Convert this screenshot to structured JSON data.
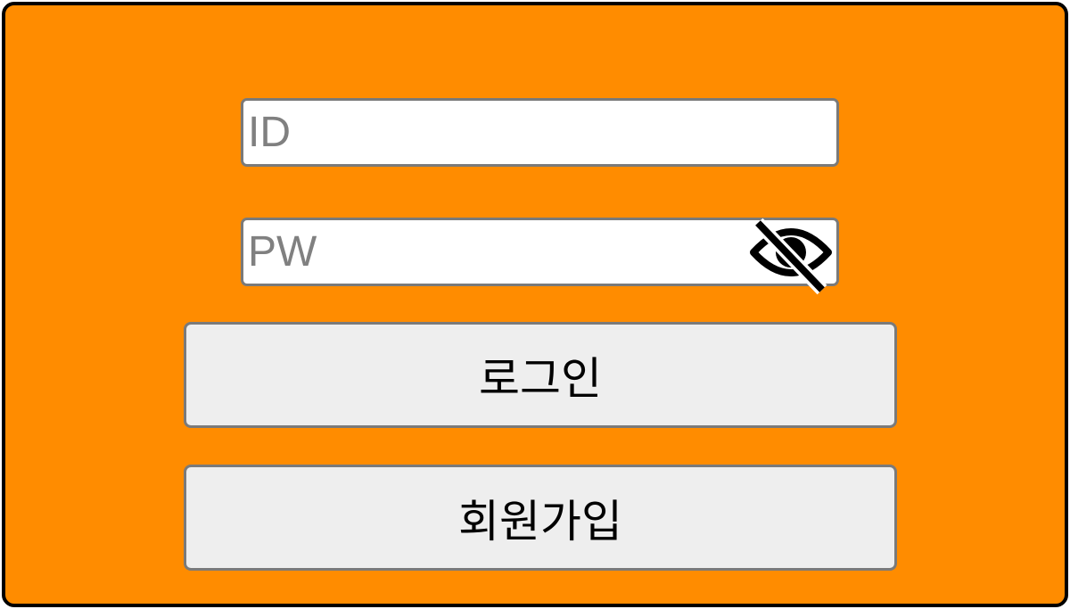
{
  "form": {
    "id_field": {
      "placeholder": "ID",
      "value": ""
    },
    "pw_field": {
      "placeholder": "PW",
      "value": ""
    },
    "visibility_toggle": {
      "icon": "eye-off-icon"
    },
    "login_label": "로그인",
    "signup_label": "회원가입"
  },
  "colors": {
    "background": "#FF8C00",
    "border": "#000000",
    "button_bg": "#EEEEEE",
    "field_border": "#7A7A7A",
    "placeholder": "#808080"
  }
}
